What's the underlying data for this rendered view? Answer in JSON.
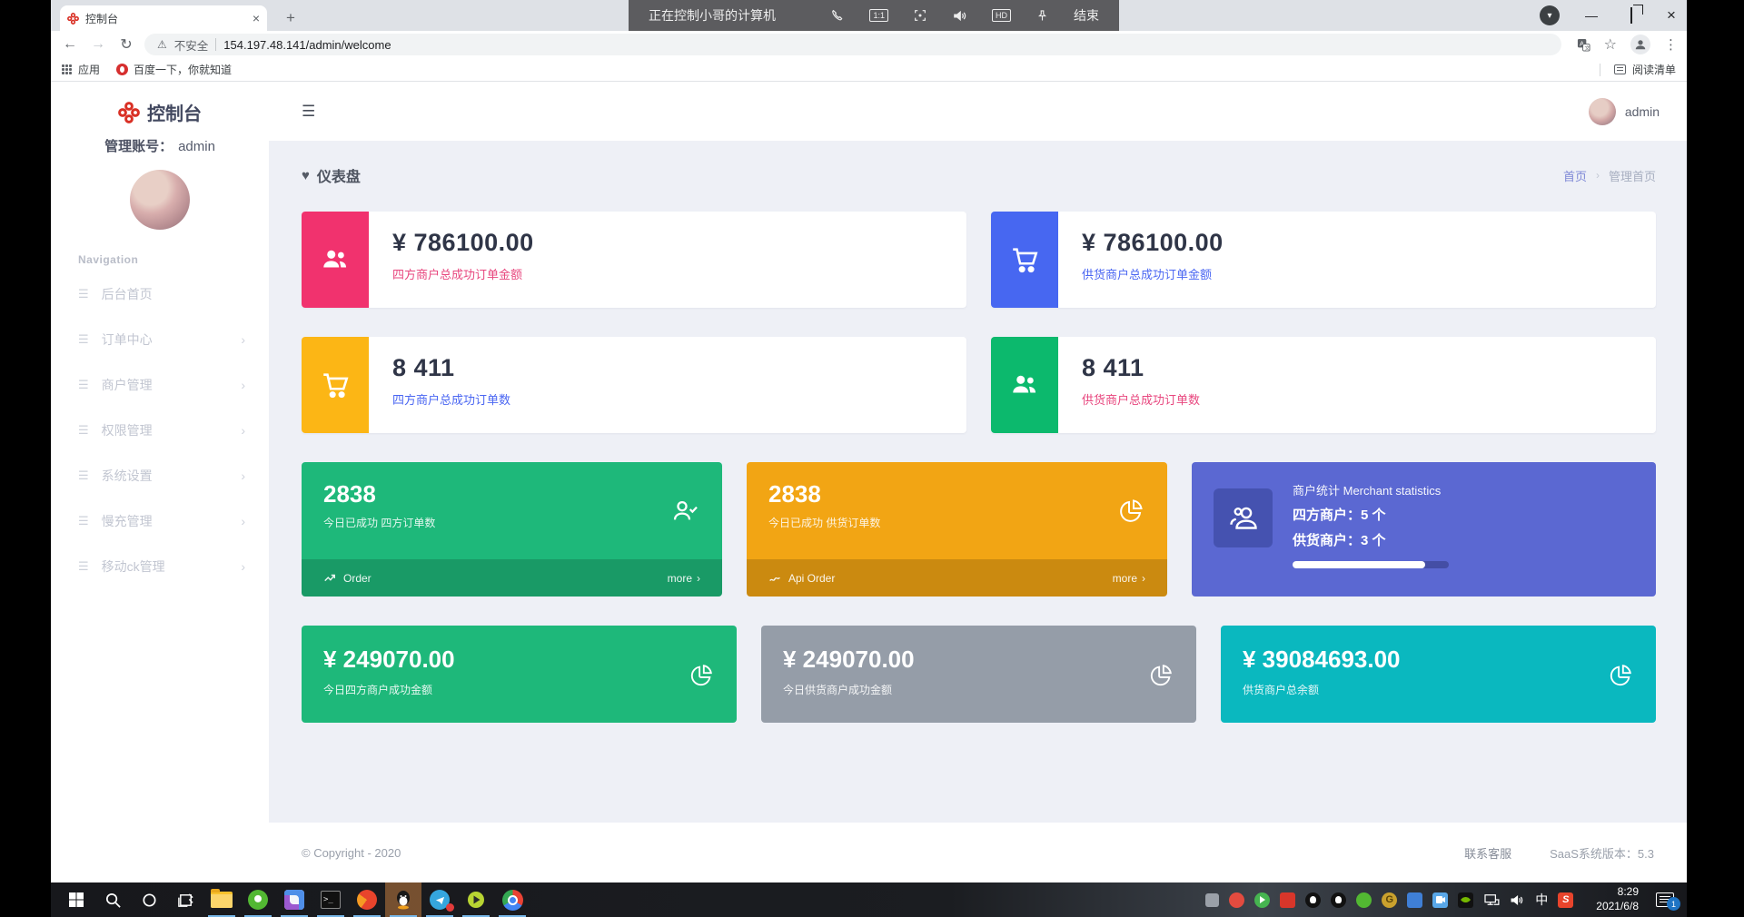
{
  "remote_bar": {
    "title": "正在控制小哥的计算机",
    "ratio_label": "1:1",
    "hd_label": "HD",
    "end_label": "结束"
  },
  "browser": {
    "tab_title": "控制台",
    "close_glyph": "×",
    "newtab_glyph": "+",
    "caret_glyph": "▾",
    "minimize_glyph": "—",
    "back_glyph": "←",
    "forward_glyph": "→",
    "reload_glyph": "↻",
    "warning_glyph": "⚠",
    "security_label": "不安全",
    "url": "154.197.48.141/admin/welcome",
    "star_glyph": "☆",
    "kebab_glyph": "⋮",
    "bookmarks": {
      "apps_label": "应用",
      "baidu_label": "百度一下，你就知道",
      "reading_list_label": "阅读清单"
    }
  },
  "sidebar": {
    "logo_title": "控制台",
    "account_label": "管理账号：",
    "account_name": "admin",
    "nav_label": "Navigation",
    "item_glyph": "☰",
    "chevron_glyph": "›",
    "items": [
      {
        "label": "后台首页"
      },
      {
        "label": "订单中心"
      },
      {
        "label": "商户管理"
      },
      {
        "label": "权限管理"
      },
      {
        "label": "系统设置"
      },
      {
        "label": "慢充管理"
      },
      {
        "label": "移动ck管理"
      }
    ]
  },
  "header": {
    "hamburger_glyph": "☰",
    "user_name": "admin"
  },
  "content": {
    "page_title": "仪表盘",
    "heart_glyph": "♥",
    "breadcrumb": {
      "home": "首页",
      "sep": "›",
      "current": "管理首页"
    },
    "stat_cards": [
      {
        "value": "¥ 786100.00",
        "label": "四方商户总成功订单金额",
        "label_color": "#e8467e",
        "block_color": "#f1326e",
        "icon": "users"
      },
      {
        "value": "¥ 786100.00",
        "label": "供货商户总成功订单金额",
        "label_color": "#4a66f2",
        "block_color": "#4767f1",
        "icon": "cart"
      },
      {
        "value": "8 411",
        "label": "四方商户总成功订单数",
        "label_color": "#4a66f2",
        "block_color": "#fcb615",
        "icon": "cart"
      },
      {
        "value": "8 411",
        "label": "供货商户总成功订单数",
        "label_color": "#e8467e",
        "block_color": "#0cb96d",
        "icon": "users"
      }
    ],
    "action_cards": [
      {
        "value": "2838",
        "label": "今日已成功 四方订单数",
        "footer_label": "Order",
        "more_label": "more",
        "color": "#1eb87a"
      },
      {
        "value": "2838",
        "label": "今日已成功 供货订单数",
        "footer_label": "Api Order",
        "more_label": "more",
        "color": "#f2a514"
      }
    ],
    "merchant_card": {
      "title": "商户统计 Merchant statistics",
      "line1": "四方商户：5 个",
      "line2": "供货商户：3 个",
      "color": "#5b68d2",
      "progress_pct": 85
    },
    "amount_cards": [
      {
        "value": "¥ 249070.00",
        "label": "今日四方商户成功金额",
        "color": "#1eb87a"
      },
      {
        "value": "¥ 249070.00",
        "label": "今日供货商户成功金额",
        "color": "#959da8"
      },
      {
        "value": "¥ 39084693.00",
        "label": "供货商户总余额",
        "color": "#0ab8bf"
      }
    ],
    "footer": {
      "copyright": "© Copyright - 2020",
      "support": "联系客服",
      "version": "SaaS系统版本：5.3"
    }
  },
  "taskbar": {
    "cmd_glyph": ">_",
    "ime_label": "中",
    "sogou_label": "S",
    "gold_label": "G",
    "clock_time": "8:29",
    "clock_date": "2021/6/8",
    "notification_badge": "1"
  },
  "colors": {
    "accent_red": "#d93025",
    "content_bg": "#eef0f6",
    "dark_value": "#2f3547"
  }
}
